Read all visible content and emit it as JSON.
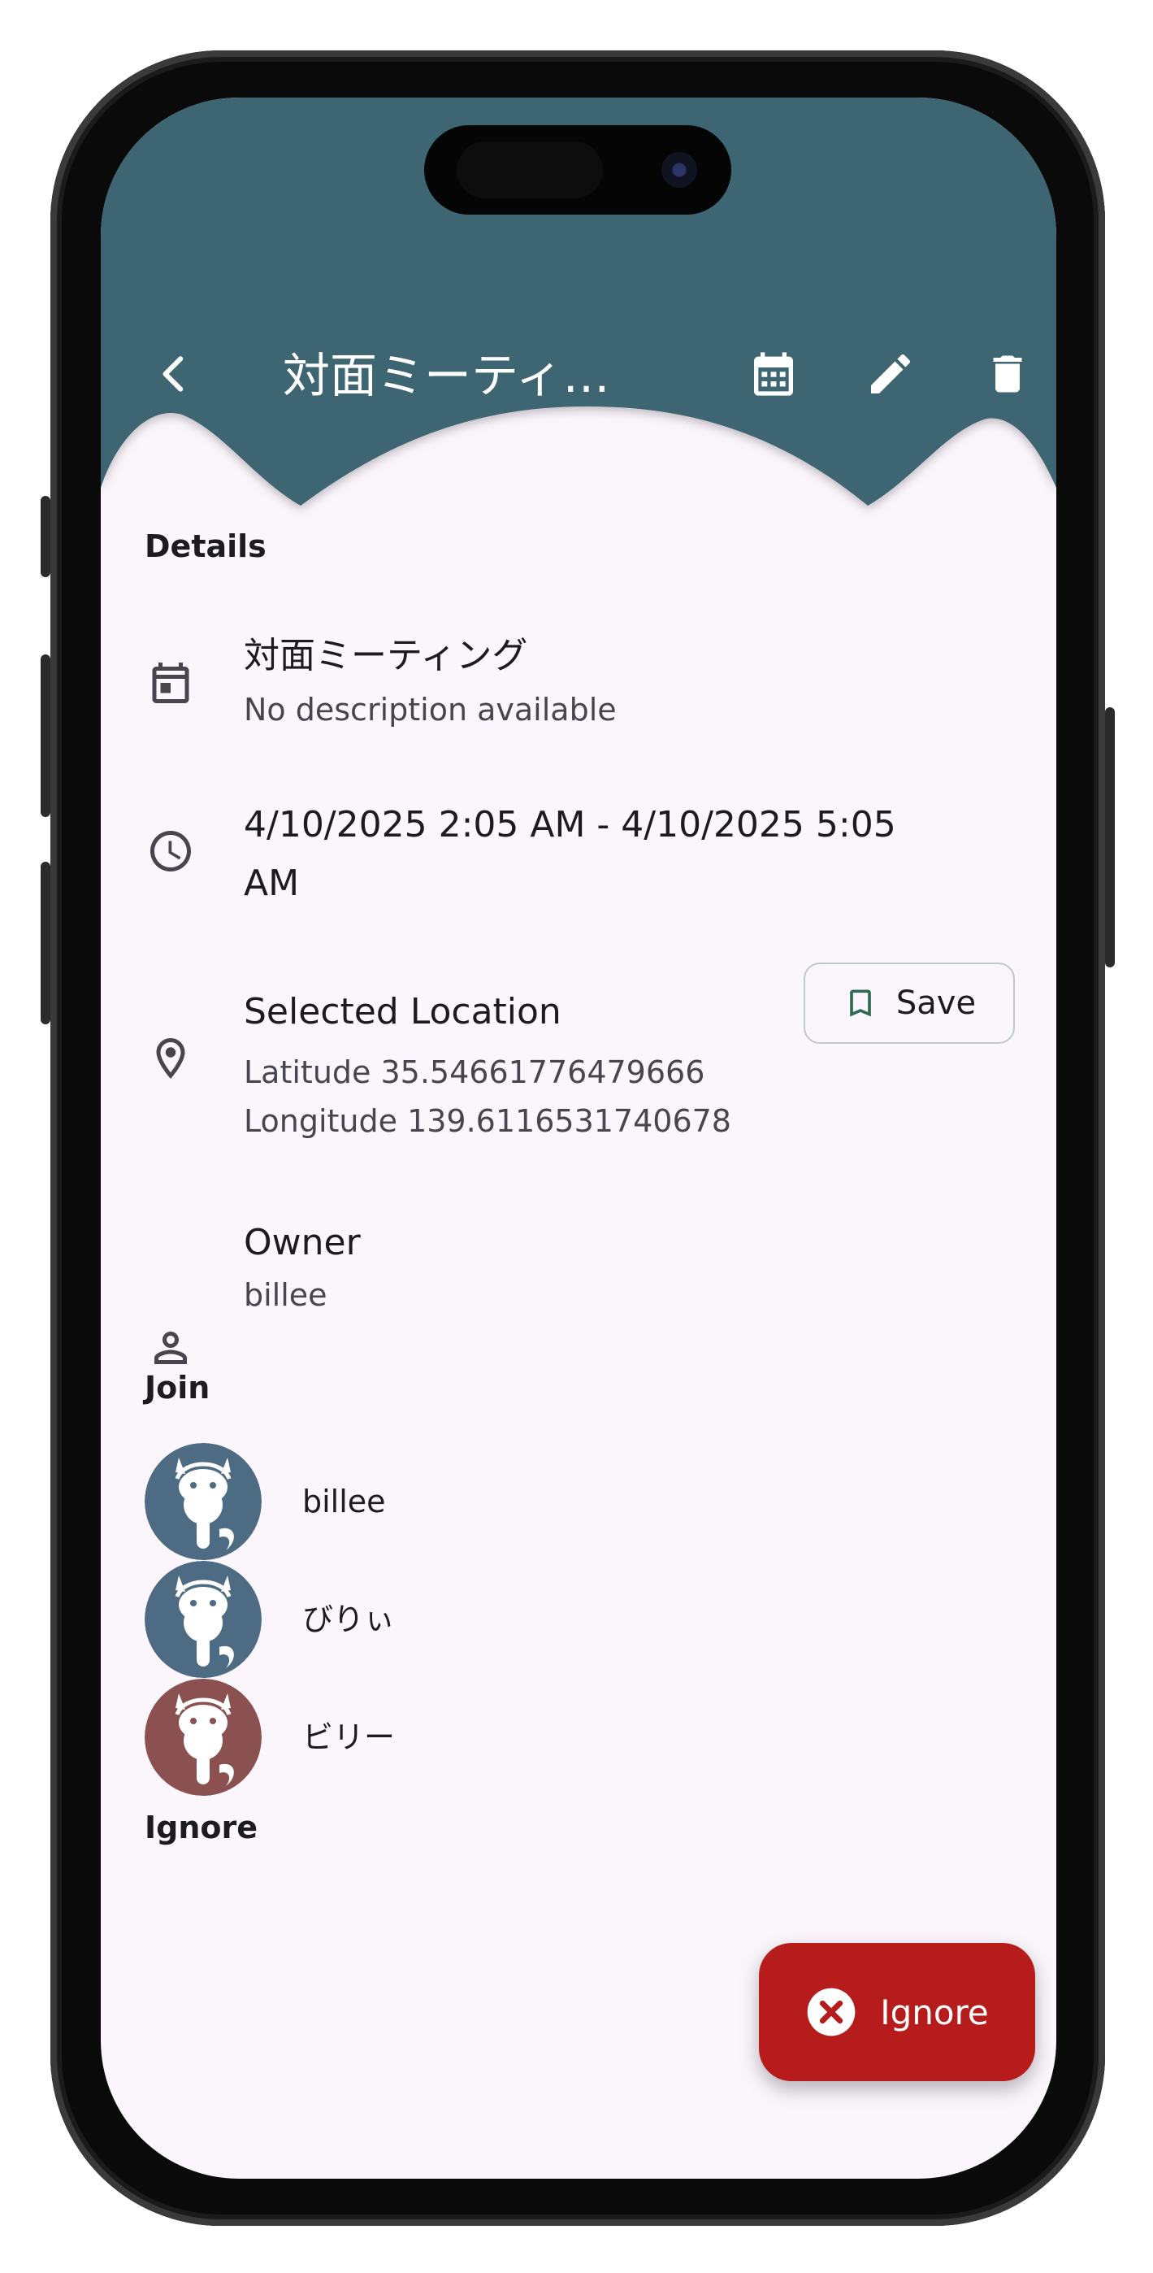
{
  "colors": {
    "header_bg": "#3e6672",
    "surface": "#fbf5fc",
    "fab_bg": "#b71c1c",
    "avatar_blue": "#4d6b82",
    "avatar_red": "#8b5050",
    "save_icon": "#2f6a52"
  },
  "appbar": {
    "title": "対面ミーティ…",
    "back_icon": "chevron-left-icon",
    "actions": [
      "calendar-icon",
      "edit-icon",
      "delete-icon"
    ]
  },
  "details": {
    "section_title": "Details",
    "event": {
      "icon": "calendar-icon",
      "title": "対面ミーティング",
      "description": "No description available"
    },
    "time": {
      "icon": "clock-icon",
      "line1": "4/10/2025 2:05 AM - 4/10/2025 5:05",
      "line2": "AM"
    },
    "location": {
      "icon": "location-pin-icon",
      "title": "Selected Location",
      "latitude": "Latitude 35.54661776479666",
      "longitude": "Longitude 139.6116531740678",
      "save_label": "Save",
      "save_icon": "bookmark-icon"
    },
    "owner": {
      "icon": "person-icon",
      "label": "Owner",
      "name": "billee"
    }
  },
  "join": {
    "section_title": "Join",
    "members": [
      {
        "name": "billee",
        "avatar_color": "#4d6b82"
      },
      {
        "name": "びりぃ",
        "avatar_color": "#4d6b82"
      },
      {
        "name": "ビリー",
        "avatar_color": "#8b5050"
      }
    ]
  },
  "ignore": {
    "section_title": "Ignore"
  },
  "fab": {
    "label": "Ignore",
    "icon": "cancel-circle-icon"
  }
}
